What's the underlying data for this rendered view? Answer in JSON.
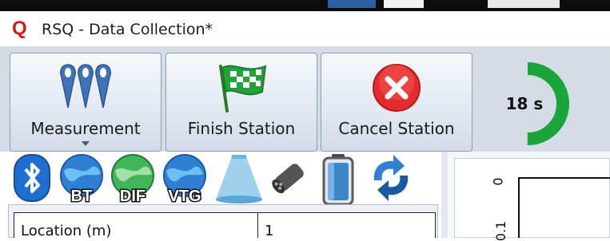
{
  "app": {
    "logo": "Q",
    "title": "RSQ - Data Collection*"
  },
  "toolbar": {
    "measurement_label": "Measurement",
    "finish_label": "Finish Station",
    "cancel_label": "Cancel Station"
  },
  "timer": {
    "value_label": "18 s",
    "progress": 0.5,
    "color": "#1aa53b"
  },
  "status_icons": [
    {
      "name": "bluetooth-icon"
    },
    {
      "name": "bt-globe-icon",
      "label": "BT"
    },
    {
      "name": "dif-globe-icon",
      "label": "DIF"
    },
    {
      "name": "vtg-globe-icon",
      "label": "VTG"
    },
    {
      "name": "beam-icon"
    },
    {
      "name": "transducer-icon"
    },
    {
      "name": "battery-icon"
    },
    {
      "name": "sync-icon"
    }
  ],
  "grid": {
    "location_label": "Location (m)",
    "location_value": "1"
  },
  "chart": {
    "tick_0": "0",
    "tick_1": "0.1"
  },
  "colors": {
    "accent_red": "#e0141a",
    "ribbon_bg": "#d6dce6",
    "timer_green": "#1aa53b"
  }
}
